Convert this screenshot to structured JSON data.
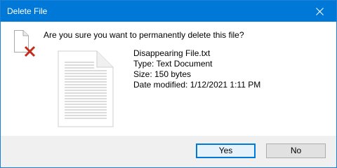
{
  "window": {
    "title": "Delete File"
  },
  "dialog": {
    "question": "Are you sure you want to permanently delete this file?",
    "file": {
      "name": "Disappearing File.txt",
      "type": "Type: Text Document",
      "size": "Size: 150 bytes",
      "modified": "Date modified: 1/12/2021 1:11 PM"
    }
  },
  "buttons": {
    "yes": "Yes",
    "no": "No"
  },
  "colors": {
    "titlebar": "#0078d7",
    "default_button_border": "#0078d7",
    "delete_x": "#c42b1c"
  },
  "icons": {
    "close": "close-icon",
    "warning": "delete-file-icon",
    "file": "text-document-icon"
  }
}
